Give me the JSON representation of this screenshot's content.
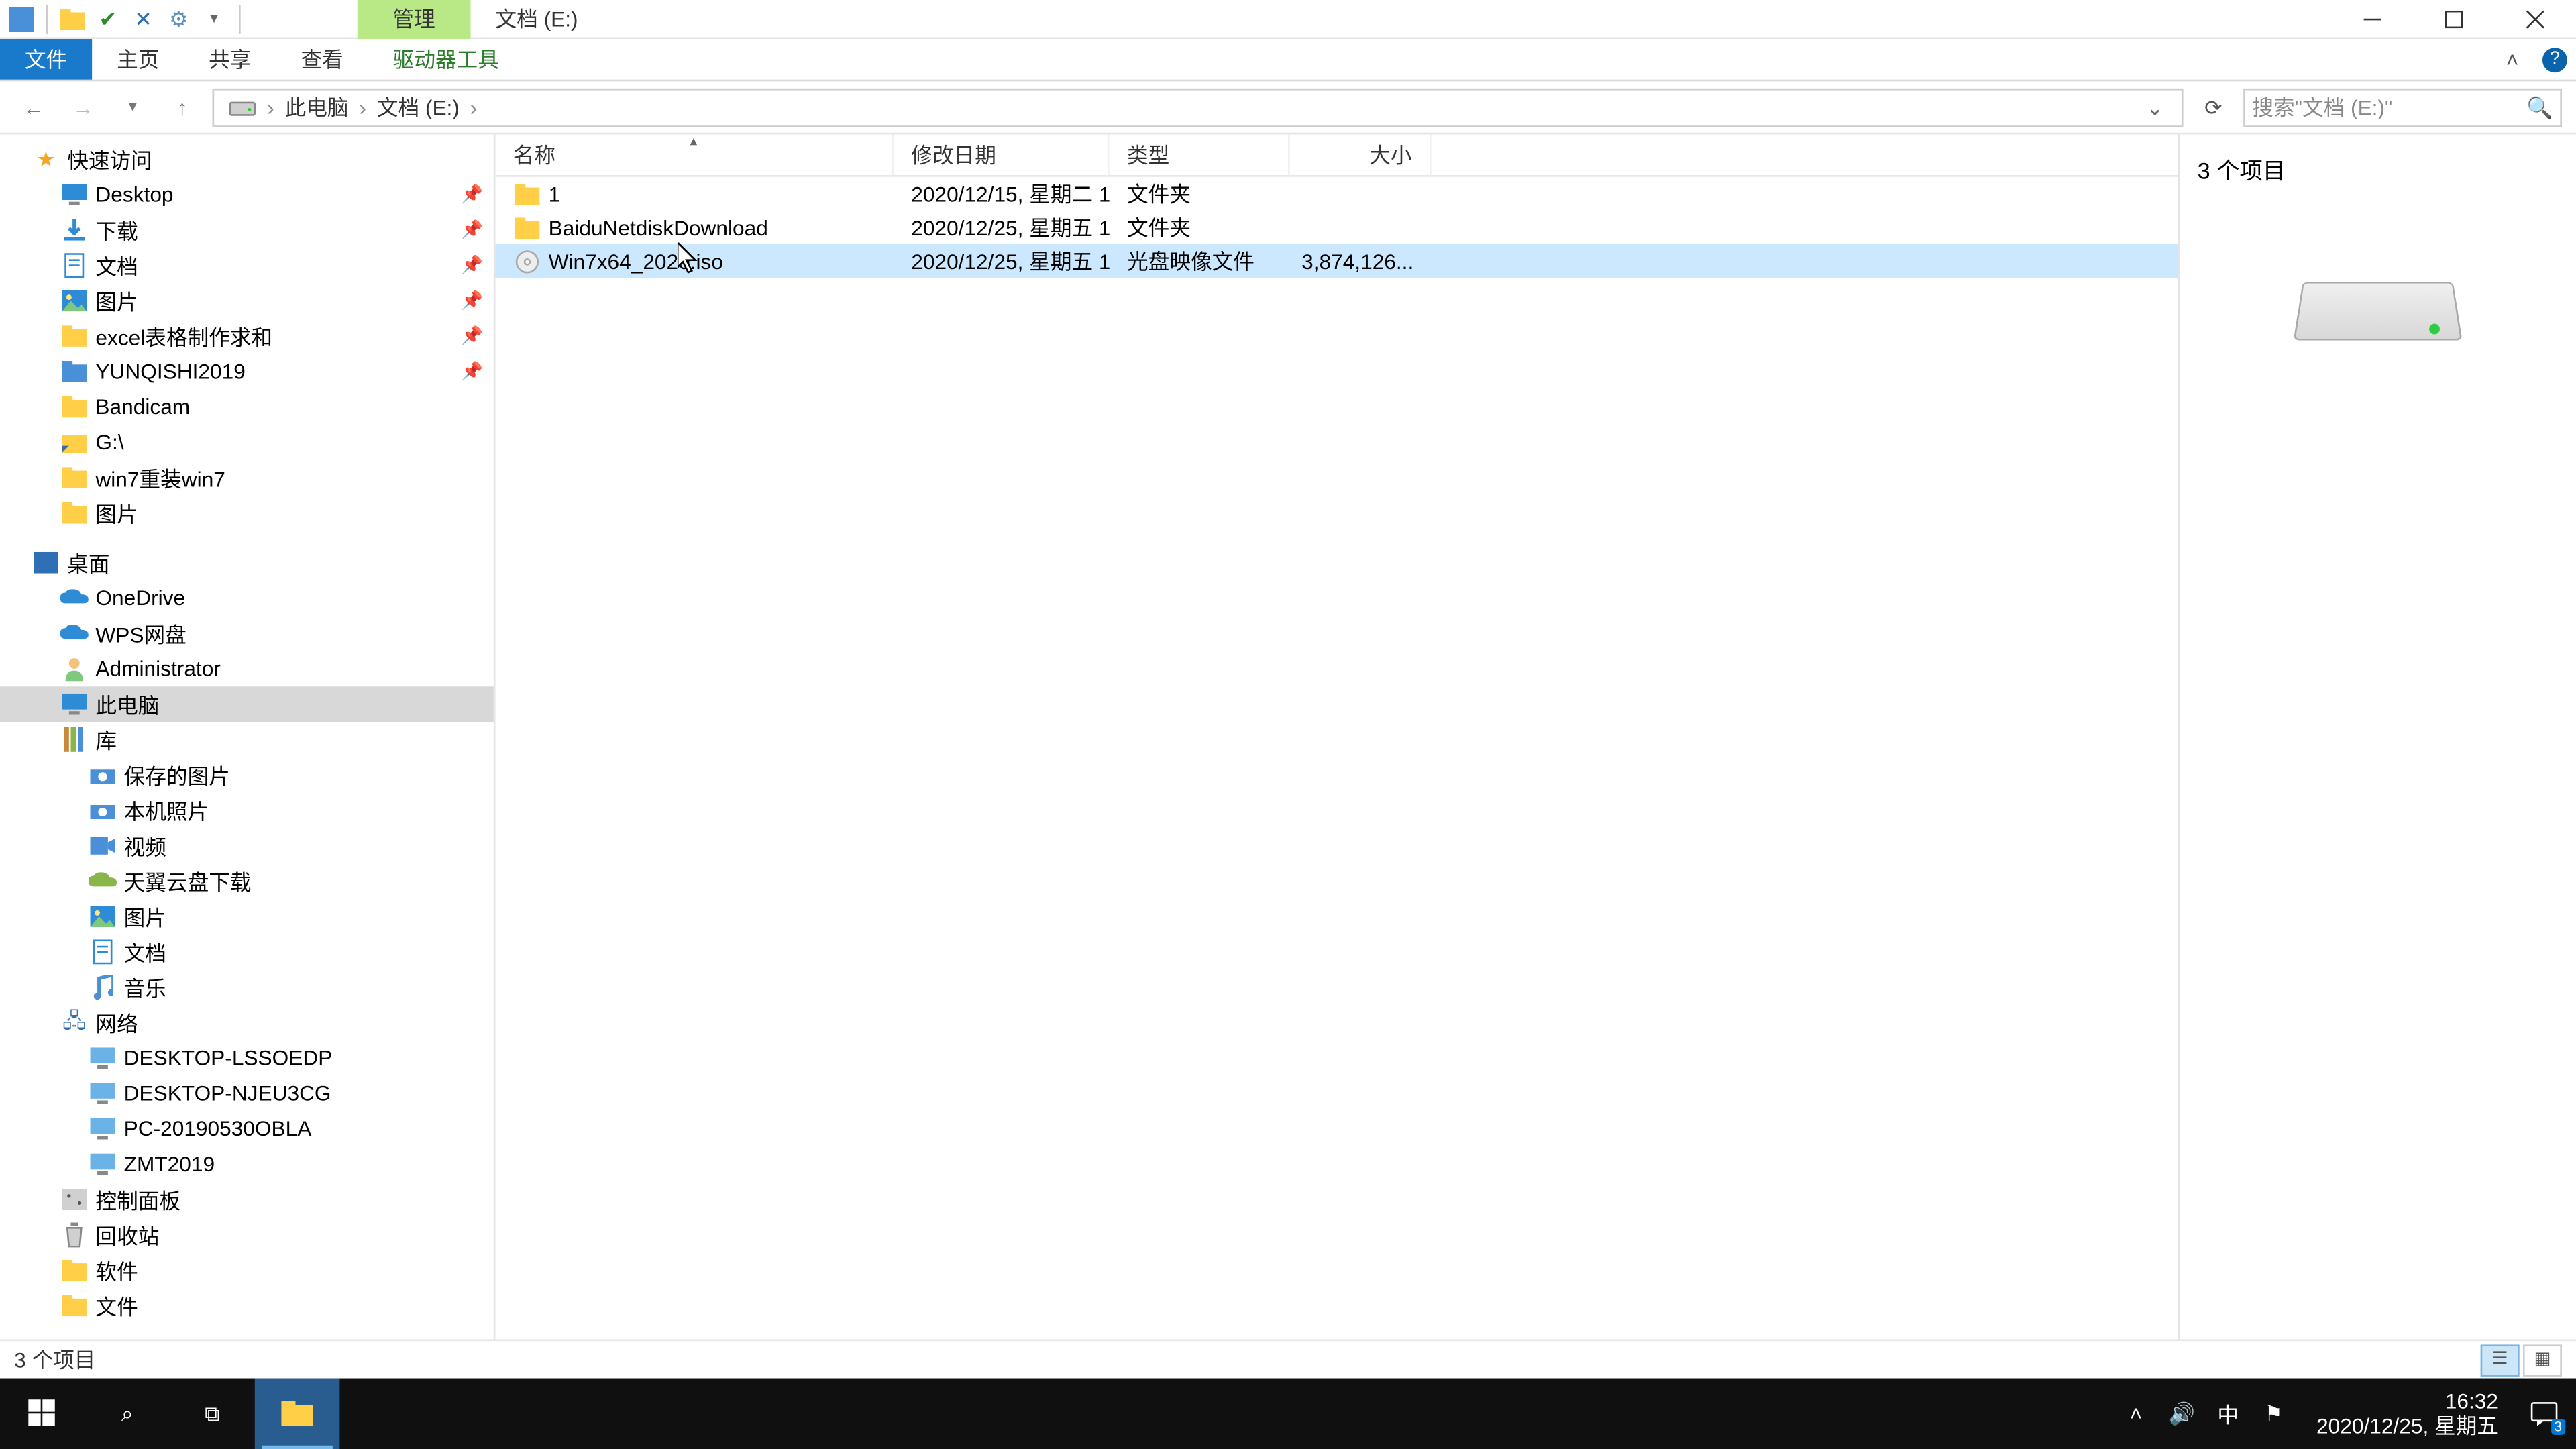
{
  "window": {
    "title_tab": "管理",
    "title_path": "文档 (E:)"
  },
  "ribbon": {
    "file": "文件",
    "home": "主页",
    "share": "共享",
    "view": "查看",
    "drive": "驱动器工具"
  },
  "breadcrumb": {
    "root": "此电脑",
    "current": "文档 (E:)"
  },
  "search": {
    "placeholder": "搜索\"文档 (E:)\""
  },
  "nav": {
    "quick_access": "快速访问",
    "items_pinned": [
      {
        "label": "Desktop",
        "icon": "desktop"
      },
      {
        "label": "下载",
        "icon": "downloads"
      },
      {
        "label": "文档",
        "icon": "documents"
      },
      {
        "label": "图片",
        "icon": "pictures"
      },
      {
        "label": "excel表格制作求和",
        "icon": "folder"
      },
      {
        "label": "YUNQISHI2019",
        "icon": "folder-blue"
      }
    ],
    "items_freq": [
      {
        "label": "Bandicam",
        "icon": "folder"
      },
      {
        "label": "G:\\",
        "icon": "shortcut"
      },
      {
        "label": "win7重装win7",
        "icon": "folder"
      },
      {
        "label": "图片",
        "icon": "folder"
      }
    ],
    "desktop": "桌面",
    "desktop_items": [
      {
        "label": "OneDrive",
        "icon": "onedrive"
      },
      {
        "label": "WPS网盘",
        "icon": "wps"
      },
      {
        "label": "Administrator",
        "icon": "user"
      },
      {
        "label": "此电脑",
        "icon": "thispc",
        "selected": true
      },
      {
        "label": "库",
        "icon": "library"
      }
    ],
    "library_items": [
      {
        "label": "保存的图片",
        "icon": "camera"
      },
      {
        "label": "本机照片",
        "icon": "camera"
      },
      {
        "label": "视频",
        "icon": "video"
      },
      {
        "label": "天翼云盘下载",
        "icon": "cloud"
      },
      {
        "label": "图片",
        "icon": "pictures"
      },
      {
        "label": "文档",
        "icon": "documents"
      },
      {
        "label": "音乐",
        "icon": "music"
      }
    ],
    "network": "网络",
    "network_items": [
      {
        "label": "DESKTOP-LSSOEDP",
        "icon": "pc"
      },
      {
        "label": "DESKTOP-NJEU3CG",
        "icon": "pc"
      },
      {
        "label": "PC-20190530OBLA",
        "icon": "pc"
      },
      {
        "label": "ZMT2019",
        "icon": "pc"
      }
    ],
    "tail": [
      {
        "label": "控制面板",
        "icon": "control"
      },
      {
        "label": "回收站",
        "icon": "recycle"
      },
      {
        "label": "软件",
        "icon": "folder"
      },
      {
        "label": "文件",
        "icon": "folder"
      }
    ]
  },
  "columns": {
    "name": "名称",
    "date": "修改日期",
    "type": "类型",
    "size": "大小"
  },
  "files": [
    {
      "name": "1",
      "date": "2020/12/15, 星期二 1...",
      "type": "文件夹",
      "size": "",
      "icon": "folder"
    },
    {
      "name": "BaiduNetdiskDownload",
      "date": "2020/12/25, 星期五 1...",
      "type": "文件夹",
      "size": "",
      "icon": "folder"
    },
    {
      "name": "Win7x64_2020.iso",
      "date": "2020/12/25, 星期五 1...",
      "type": "光盘映像文件",
      "size": "3,874,126...",
      "icon": "iso",
      "selected": true
    }
  ],
  "preview": {
    "count_label": "3 个项目"
  },
  "statusbar": {
    "count": "3 个项目"
  },
  "taskbar": {
    "time": "16:32",
    "date": "2020/12/25, 星期五",
    "ime": "中",
    "notif_count": "3"
  }
}
